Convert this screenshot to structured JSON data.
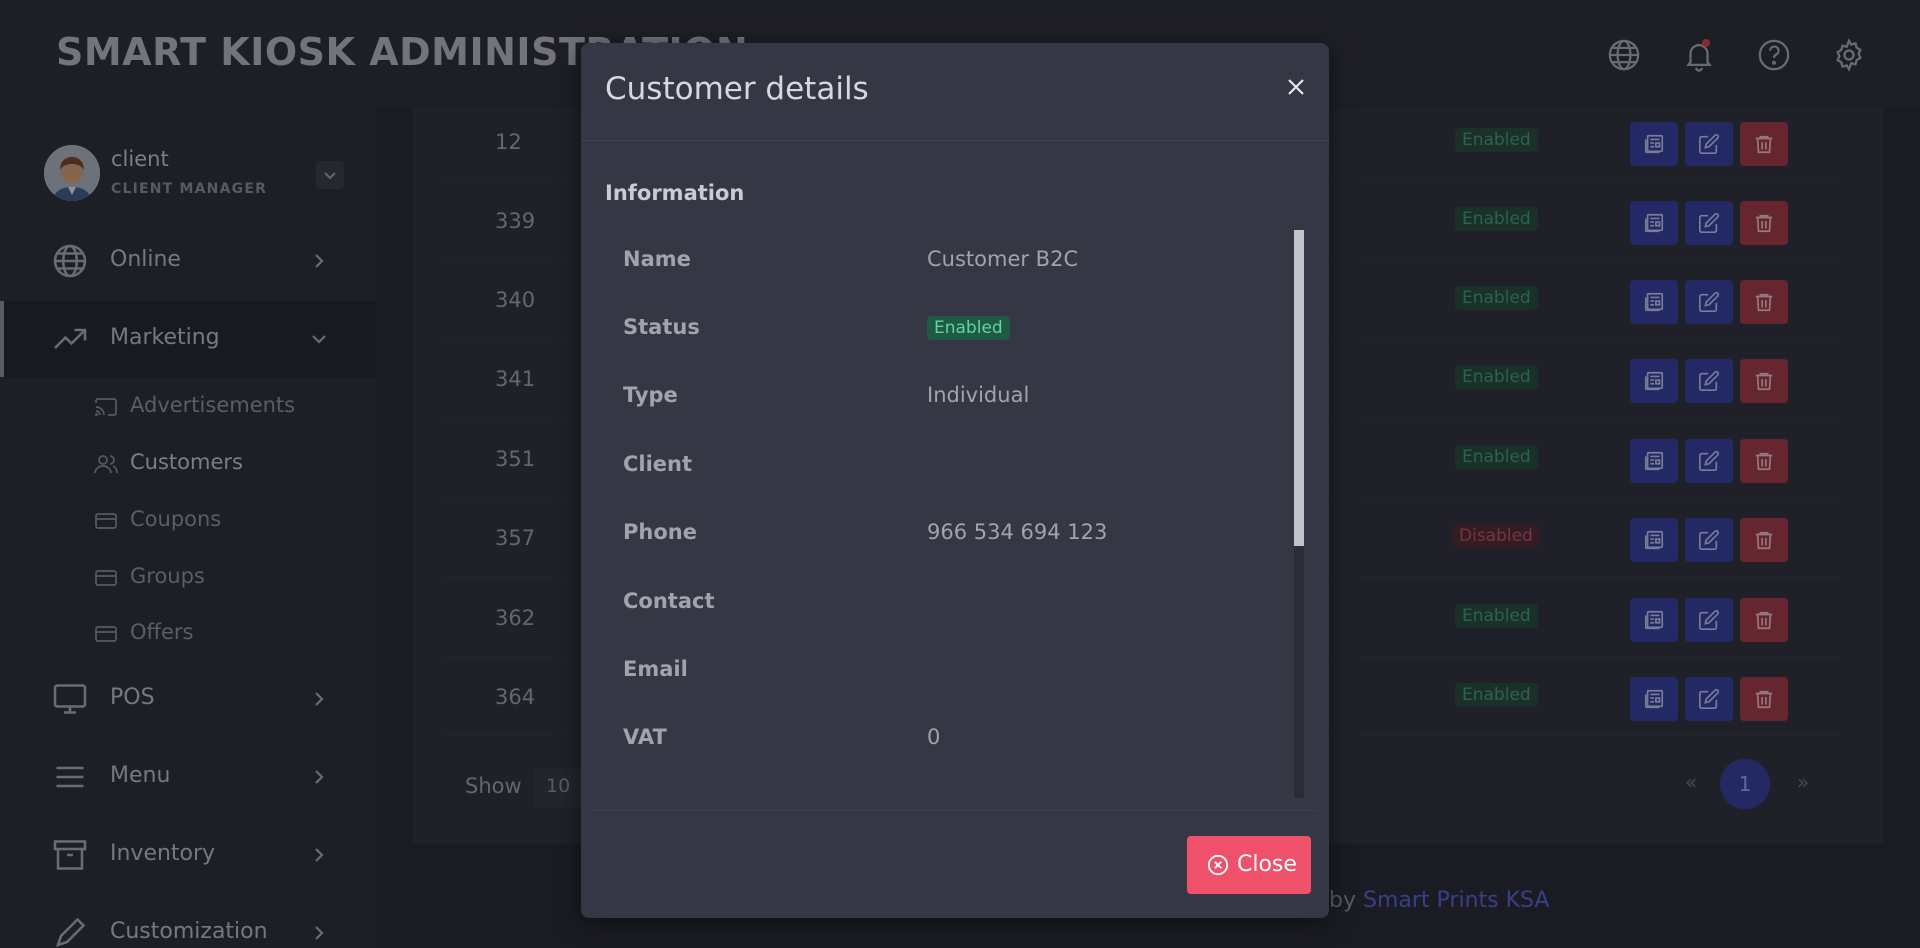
{
  "header": {
    "brand": "SMART KIOSK ADMINISTRATION",
    "icons": [
      "globe-icon",
      "bell-icon",
      "help-icon",
      "gear-icon"
    ]
  },
  "user": {
    "name": "client",
    "role": "CLIENT MANAGER"
  },
  "nav": {
    "online": "Online",
    "marketing": "Marketing",
    "advertisements": "Advertisements",
    "customers": "Customers",
    "coupons": "Coupons",
    "groups": "Groups",
    "offers": "Offers",
    "pos": "POS",
    "menu": "Menu",
    "inventory": "Inventory",
    "customization": "Customization"
  },
  "table": {
    "rows": [
      {
        "id": "12",
        "status": "Enabled"
      },
      {
        "id": "339",
        "status": "Enabled"
      },
      {
        "id": "340",
        "status": "Enabled"
      },
      {
        "id": "341",
        "status": "Enabled"
      },
      {
        "id": "351",
        "status": "Enabled"
      },
      {
        "id": "357",
        "status": "Disabled"
      },
      {
        "id": "362",
        "status": "Enabled"
      },
      {
        "id": "364",
        "status": "Enabled"
      }
    ],
    "show_label": "Show",
    "show_value": "10",
    "pagination": {
      "prev": "«",
      "current": "1",
      "next": "»"
    }
  },
  "footer": {
    "prefix": "by ",
    "link": "Smart Prints KSA"
  },
  "modal": {
    "title": "Customer details",
    "section": "Information",
    "fields": {
      "name_label": "Name",
      "name_value": "Customer B2C",
      "status_label": "Status",
      "status_value": "Enabled",
      "type_label": "Type",
      "type_value": "Individual",
      "client_label": "Client",
      "client_value": "",
      "phone_label": "Phone",
      "phone_value": "966 534 694 123",
      "contact_label": "Contact",
      "contact_value": "",
      "email_label": "Email",
      "email_value": "",
      "vat_label": "VAT",
      "vat_value": "0"
    },
    "close_label": "Close"
  },
  "colors": {
    "primary": "#2d3a9e",
    "danger": "#f0516a",
    "success": "#1f5a45"
  }
}
